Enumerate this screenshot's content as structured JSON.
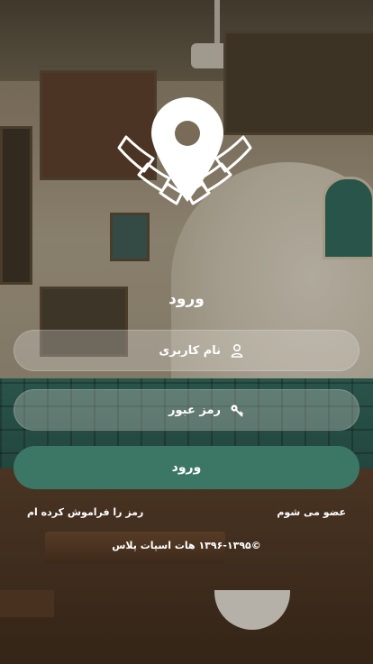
{
  "login": {
    "title": "ورود",
    "username_placeholder": "نام کاربری",
    "password_placeholder": "رمز عبور",
    "submit_label": "ورود",
    "forgot_password": "رمز را فراموش کرده ام",
    "signup": "عضو می شوم"
  },
  "footer": {
    "copyright": "©۱۳۹۶-۱۳۹۵ هات اسپات پلاس"
  },
  "icons": {
    "logo": "wifi-location-pin-icon",
    "user": "user-icon",
    "key": "key-icon"
  },
  "colors": {
    "accent": "#3c7766",
    "text": "#ffffff"
  }
}
